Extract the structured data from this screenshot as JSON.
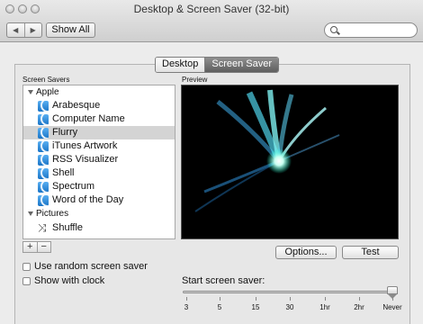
{
  "window": {
    "title": "Desktop & Screen Saver (32-bit)"
  },
  "toolbar": {
    "back_glyph": "◀",
    "forward_glyph": "▶",
    "show_all_label": "Show All",
    "search_placeholder": ""
  },
  "tabs": [
    {
      "label": "Desktop",
      "selected": false
    },
    {
      "label": "Screen Saver",
      "selected": true
    }
  ],
  "screen_savers": {
    "header": "Screen Savers",
    "groups": [
      {
        "label": "Apple",
        "expanded": true,
        "items": [
          {
            "label": "Arabesque",
            "icon": "screensaver-icon",
            "selected": false
          },
          {
            "label": "Computer Name",
            "icon": "screensaver-icon",
            "selected": false
          },
          {
            "label": "Flurry",
            "icon": "screensaver-icon",
            "selected": true
          },
          {
            "label": "iTunes Artwork",
            "icon": "screensaver-icon",
            "selected": false
          },
          {
            "label": "RSS Visualizer",
            "icon": "screensaver-icon",
            "selected": false
          },
          {
            "label": "Shell",
            "icon": "screensaver-icon",
            "selected": false
          },
          {
            "label": "Spectrum",
            "icon": "screensaver-icon",
            "selected": false
          },
          {
            "label": "Word of the Day",
            "icon": "screensaver-icon",
            "selected": false
          }
        ]
      },
      {
        "label": "Pictures",
        "expanded": true,
        "items": [
          {
            "label": "Shuffle",
            "icon": "shuffle-icon",
            "selected": false
          }
        ]
      }
    ],
    "add_label": "+",
    "remove_label": "−"
  },
  "options": {
    "random_label": "Use random screen saver",
    "random_checked": false,
    "clock_label": "Show with clock",
    "clock_checked": false
  },
  "preview": {
    "header": "Preview",
    "options_label": "Options...",
    "test_label": "Test"
  },
  "start": {
    "label": "Start screen saver:",
    "ticks": [
      "3",
      "5",
      "15",
      "30",
      "1hr",
      "2hr",
      "Never"
    ],
    "selected": "Never"
  },
  "colors": {
    "selection": "#d4d4d4",
    "tab_selected": "#6f6f6f",
    "icon_blue": "#2a86d8"
  }
}
